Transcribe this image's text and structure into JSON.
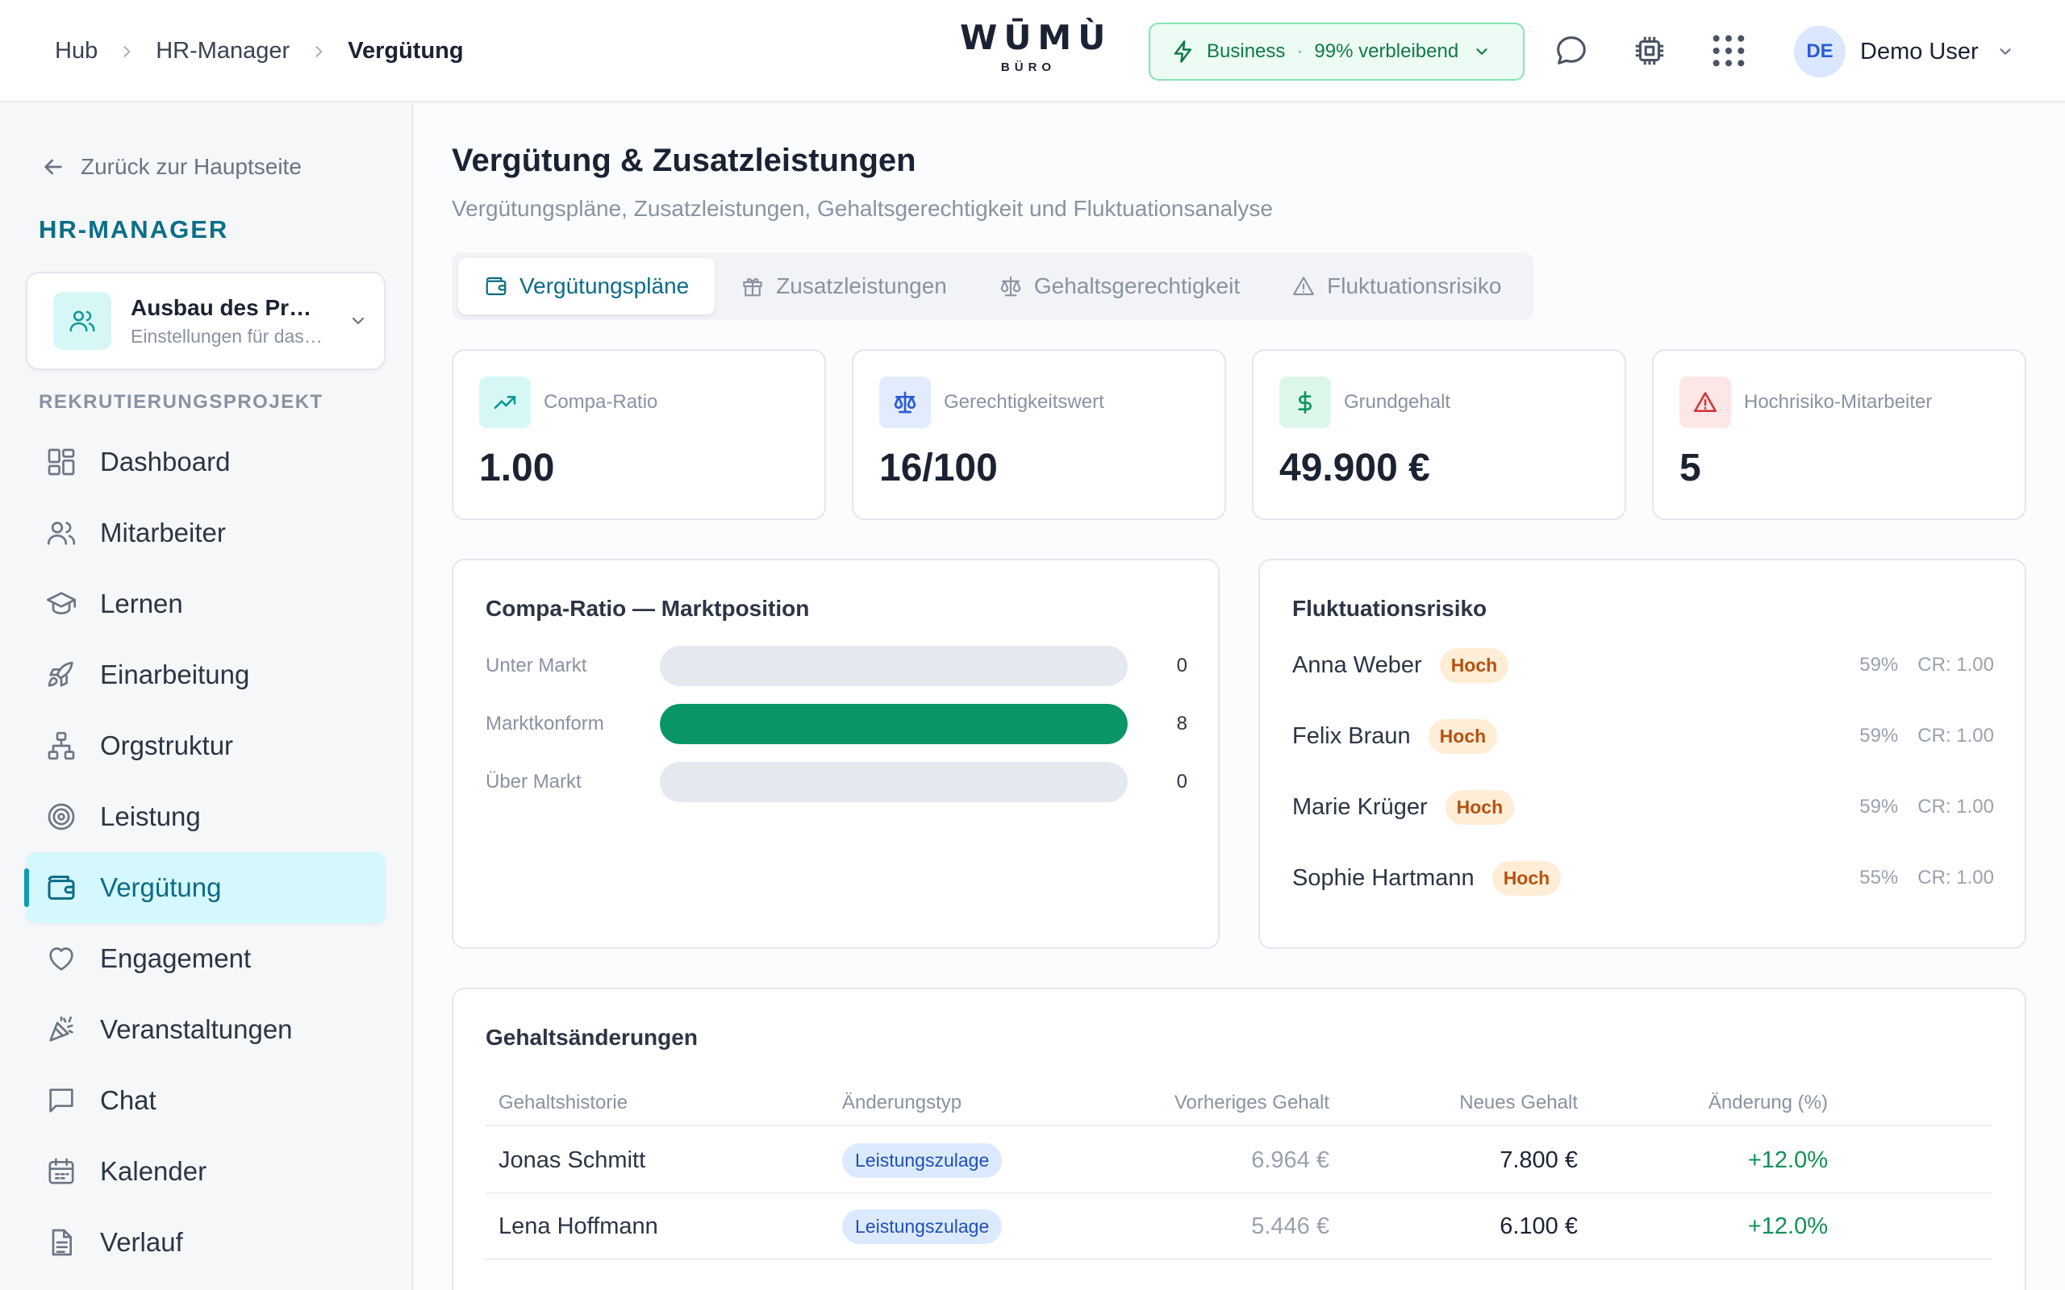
{
  "breadcrumb": [
    "Hub",
    "HR-Manager",
    "Vergütung"
  ],
  "logo": {
    "main": "WŪMÙ",
    "sub": "BÜRO"
  },
  "plan": {
    "name": "Business",
    "separator": "·",
    "remaining": "99% verbleibend",
    "color": "#0f7a47"
  },
  "topbar_icons": [
    "chat-bubble-icon",
    "chip-icon",
    "apps-grid-icon"
  ],
  "user": {
    "initials": "DE",
    "name": "Demo User"
  },
  "sidebar": {
    "back_label": "Zurück zur Hauptseite",
    "module_title": "HR-MANAGER",
    "project": {
      "name": "Ausbau des Produktteams",
      "subtitle": "Einstellungen für das Projekt"
    },
    "section_label": "REKRUTIERUNGSPROJEKT",
    "items": [
      {
        "label": "Dashboard",
        "icon": "dashboard-icon"
      },
      {
        "label": "Mitarbeiter",
        "icon": "users-icon"
      },
      {
        "label": "Lernen",
        "icon": "graduation-cap-icon"
      },
      {
        "label": "Einarbeitung",
        "icon": "rocket-icon"
      },
      {
        "label": "Orgstruktur",
        "icon": "org-chart-icon"
      },
      {
        "label": "Leistung",
        "icon": "target-icon"
      },
      {
        "label": "Vergütung",
        "icon": "wallet-icon",
        "active": true
      },
      {
        "label": "Engagement",
        "icon": "heart-icon"
      },
      {
        "label": "Veranstaltungen",
        "icon": "party-popper-icon"
      },
      {
        "label": "Chat",
        "icon": "chat-icon"
      },
      {
        "label": "Kalender",
        "icon": "calendar-icon"
      },
      {
        "label": "Verlauf",
        "icon": "document-icon"
      }
    ],
    "active_color": "#0c6b86"
  },
  "main": {
    "title": "Vergütung & Zusatzleistungen",
    "subtitle": "Vergütungspläne, Zusatzleistungen, Gehaltsgerechtigkeit und Fluktuationsanalyse",
    "tabs": [
      {
        "label": "Vergütungspläne",
        "icon": "wallet-icon",
        "active": true
      },
      {
        "label": "Zusatzleistungen",
        "icon": "gift-icon"
      },
      {
        "label": "Gehaltsgerechtigkeit",
        "icon": "scale-icon"
      },
      {
        "label": "Fluktuationsrisiko",
        "icon": "alert-triangle-icon"
      }
    ],
    "stats": [
      {
        "label": "Compa-Ratio",
        "value": "1.00",
        "icon": "trending-up-icon",
        "color": "#119999"
      },
      {
        "label": "Gerechtigkeitswert",
        "value": "16/100",
        "icon": "scale-icon",
        "color": "#2b5bd7"
      },
      {
        "label": "Grundgehalt",
        "value": "49.900 €",
        "icon": "dollar-icon",
        "color": "#0a9565"
      },
      {
        "label": "Hochrisiko-Mitarbeiter",
        "value": "5",
        "icon": "alert-triangle-icon",
        "color": "#d03a3a"
      }
    ],
    "compa_panel": {
      "title": "Compa-Ratio — Marktposition",
      "rows": [
        {
          "label": "Unter Markt",
          "value": 0,
          "display": "0"
        },
        {
          "label": "Marktkonform",
          "value": 8,
          "display": "8"
        },
        {
          "label": "Über Markt",
          "value": 0,
          "display": "0"
        }
      ],
      "max": 8,
      "bar_color": "#0a9565"
    },
    "risk_panel": {
      "title": "Fluktuationsrisiko",
      "employees": [
        {
          "name": "Anna Weber",
          "level": "Hoch",
          "risk": "59%",
          "cr": "CR: 1.00"
        },
        {
          "name": "Felix Braun",
          "level": "Hoch",
          "risk": "59%",
          "cr": "CR: 1.00"
        },
        {
          "name": "Marie Krüger",
          "level": "Hoch",
          "risk": "59%",
          "cr": "CR: 1.00"
        },
        {
          "name": "Sophie Hartmann",
          "level": "Hoch",
          "risk": "55%",
          "cr": "CR: 1.00"
        }
      ]
    },
    "changes_panel": {
      "title": "Gehaltsänderungen",
      "columns": [
        "Gehaltshistorie",
        "Änderungstyp",
        "Vorheriges Gehalt",
        "Neues Gehalt",
        "Änderung (%)"
      ],
      "rows": [
        {
          "name": "Jonas Schmitt",
          "type": "Leistungszulage",
          "previous": "6.964 €",
          "new": "7.800 €",
          "change": "+12.0%"
        },
        {
          "name": "Lena Hoffmann",
          "type": "Leistungszulage",
          "previous": "5.446 €",
          "new": "6.100 €",
          "change": "+12.0%"
        }
      ]
    }
  }
}
